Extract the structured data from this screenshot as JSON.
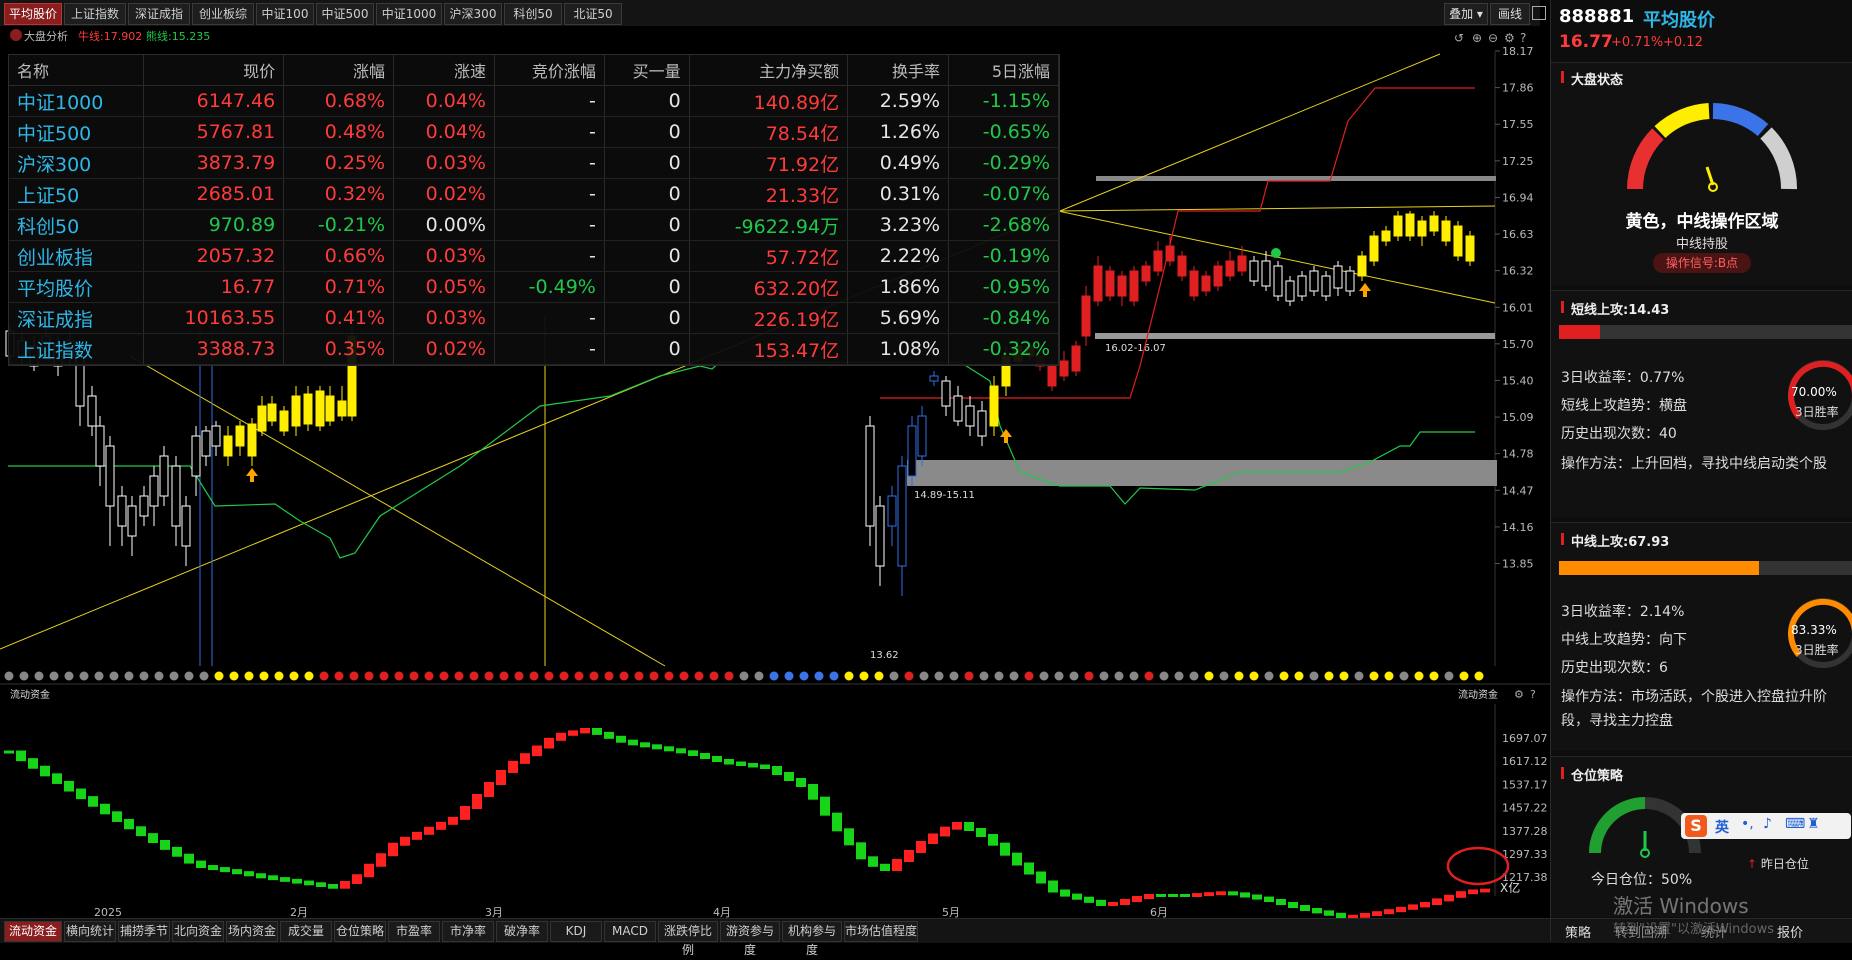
{
  "top_tabs": [
    "平均股价",
    "上证指数",
    "深证成指",
    "创业板综",
    "中证100",
    "中证500",
    "中证1000",
    "沪深300",
    "科创50",
    "北证50"
  ],
  "toolbar": {
    "overlay": "叠加",
    "draw": "画线"
  },
  "chart_header": {
    "title": "大盘分析",
    "bull_line": "牛线:17.902",
    "bear_line": "熊线:15.235"
  },
  "price_axis": [
    "18.17",
    "17.86",
    "17.55",
    "17.25",
    "16.94",
    "16.63",
    "16.32",
    "16.01",
    "15.70",
    "15.40",
    "15.09",
    "14.78",
    "14.47",
    "14.16",
    "13.85"
  ],
  "annotations": {
    "upper_zone": "16.02-16.07",
    "lower_zone": "14.89-15.11",
    "low_price": "13.62"
  },
  "quote_table": {
    "headers": [
      "名称",
      "现价",
      "涨幅",
      "涨速",
      "竞价涨幅",
      "买一量",
      "主力净买额",
      "换手率",
      "5日涨幅"
    ],
    "rows": [
      [
        "中证1000",
        "6147.46",
        "0.68%",
        "0.04%",
        "-",
        "0",
        "140.89亿",
        "2.59%",
        "-1.15%"
      ],
      [
        "中证500",
        "5767.81",
        "0.48%",
        "0.04%",
        "-",
        "0",
        "78.54亿",
        "1.26%",
        "-0.65%"
      ],
      [
        "沪深300",
        "3873.79",
        "0.25%",
        "0.03%",
        "-",
        "0",
        "71.92亿",
        "0.49%",
        "-0.29%"
      ],
      [
        "上证50",
        "2685.01",
        "0.32%",
        "0.02%",
        "-",
        "0",
        "21.33亿",
        "0.31%",
        "-0.07%"
      ],
      [
        "科创50",
        "970.89",
        "-0.21%",
        "0.00%",
        "-",
        "0",
        "-9622.94万",
        "3.23%",
        "-2.68%"
      ],
      [
        "创业板指",
        "2057.32",
        "0.66%",
        "0.03%",
        "-",
        "0",
        "57.72亿",
        "2.22%",
        "-0.19%"
      ],
      [
        "平均股价",
        "16.77",
        "0.71%",
        "0.05%",
        "-0.49%",
        "0",
        "632.20亿",
        "1.86%",
        "-0.95%"
      ],
      [
        "深证成指",
        "10163.55",
        "0.41%",
        "0.03%",
        "-",
        "0",
        "226.19亿",
        "5.69%",
        "-0.84%"
      ],
      [
        "上证指数",
        "3388.73",
        "0.35%",
        "0.02%",
        "-",
        "0",
        "153.47亿",
        "1.08%",
        "-0.32%"
      ]
    ]
  },
  "sub_chart": {
    "title": "流动资金",
    "title_right": "流动资金",
    "axis": [
      "1697.07",
      "1617.12",
      "1537.17",
      "1457.22",
      "1377.28",
      "1297.33",
      "1217.38"
    ],
    "unit": "X亿"
  },
  "time_axis": [
    "2025",
    "2月",
    "3月",
    "4月",
    "5月",
    "6月"
  ],
  "bottom_tabs": [
    "流动资金",
    "横向统计",
    "捕捞季节",
    "北向资金",
    "场内资金",
    "成交量",
    "仓位策略",
    "市盈率",
    "市净率",
    "破净率",
    "KDJ",
    "MACD",
    "涨跌停比例",
    "游资参与度",
    "机构参与度",
    "市场估值程度"
  ],
  "right_panel": {
    "code": "888881",
    "name": "平均股价",
    "price": "16.77",
    "change_pct": "+0.71%",
    "change": "+0.12",
    "market_state": {
      "title": "大盘状态",
      "state": "黄色，中线操作区域",
      "advice": "中线持股",
      "signal": "操作信号:B点"
    },
    "short_attack": {
      "title": "短线上攻:14.43",
      "progress": 0.14,
      "ret3": "3日收益率：0.77%",
      "trend": "短线上攻趋势：横盘",
      "count": "历史出现次数：40",
      "method": "操作方法：上升回档，寻找中线启动类个股",
      "win": "70.00%",
      "win_label": "3日胜率"
    },
    "mid_attack": {
      "title": "中线上攻:67.93",
      "progress": 0.68,
      "ret3": "3日收益率：2.14%",
      "trend": "中线上攻趋势：向下",
      "count": "历史出现次数：6",
      "method": "操作方法：市场活跃，个股进入控盘拉升阶段，寻找主力控盘",
      "win": "83.33%",
      "win_label": "3日胜率"
    },
    "position": {
      "title": "仓位策略",
      "today": "今日仓位：50%",
      "yesterday": "昨日仓位"
    },
    "bottom_bar": [
      "策略",
      "转到回溯",
      "统计",
      "报价"
    ],
    "watermark": "激活 Windows",
    "watermark_sub": "转到\"设置\"以激活Windows",
    "ime": "英"
  },
  "colors": {
    "up": "#ff3b3b",
    "down": "#20c84a",
    "accent": "#2fb6e6",
    "yellow": "#ffee00"
  }
}
